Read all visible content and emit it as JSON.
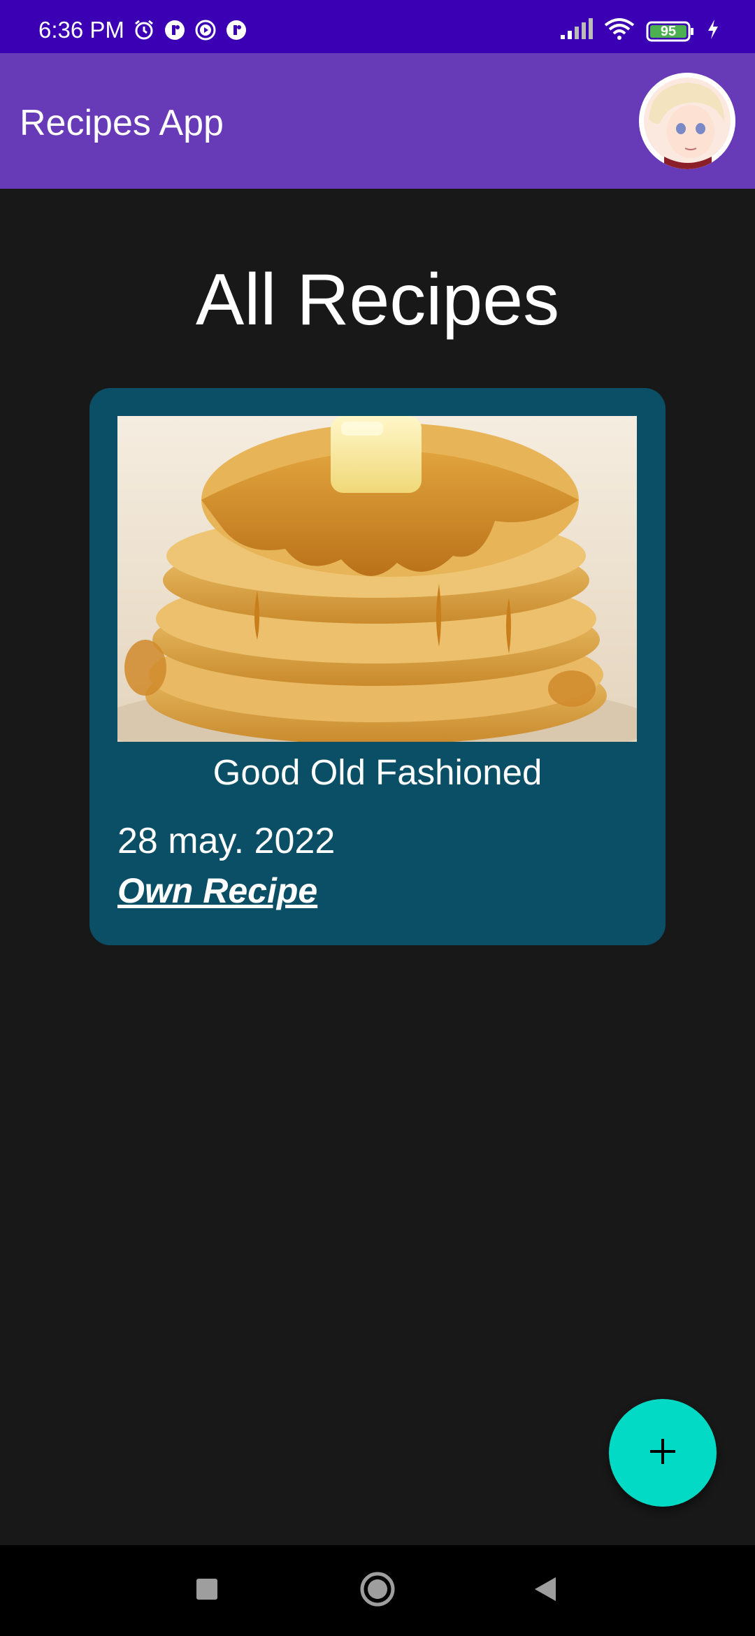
{
  "status_bar": {
    "time": "6:36 PM",
    "battery": "95",
    "icons": [
      "alarm-icon",
      "notification-icon",
      "play-icon",
      "notification-icon",
      "signal-icon",
      "wifi-icon",
      "battery-icon",
      "charging-icon"
    ]
  },
  "app_bar": {
    "title": "Recipes App",
    "avatar_icon": "avatar-icon"
  },
  "main": {
    "heading": "All Recipes",
    "recipes": [
      {
        "title": "Good Old Fashioned",
        "date": "28 may. 2022",
        "source": "Own Recipe",
        "image": "pancakes-image"
      }
    ]
  },
  "fab": {
    "icon": "plus-icon",
    "color": "#03dac5"
  },
  "nav_bar": {
    "icons": [
      "recents-icon",
      "home-icon",
      "back-icon"
    ]
  },
  "colors": {
    "status_bar": "#3c00b4",
    "app_bar": "#673ab7",
    "background": "#181818",
    "card": "#0a4f66",
    "accent": "#03dac5"
  }
}
